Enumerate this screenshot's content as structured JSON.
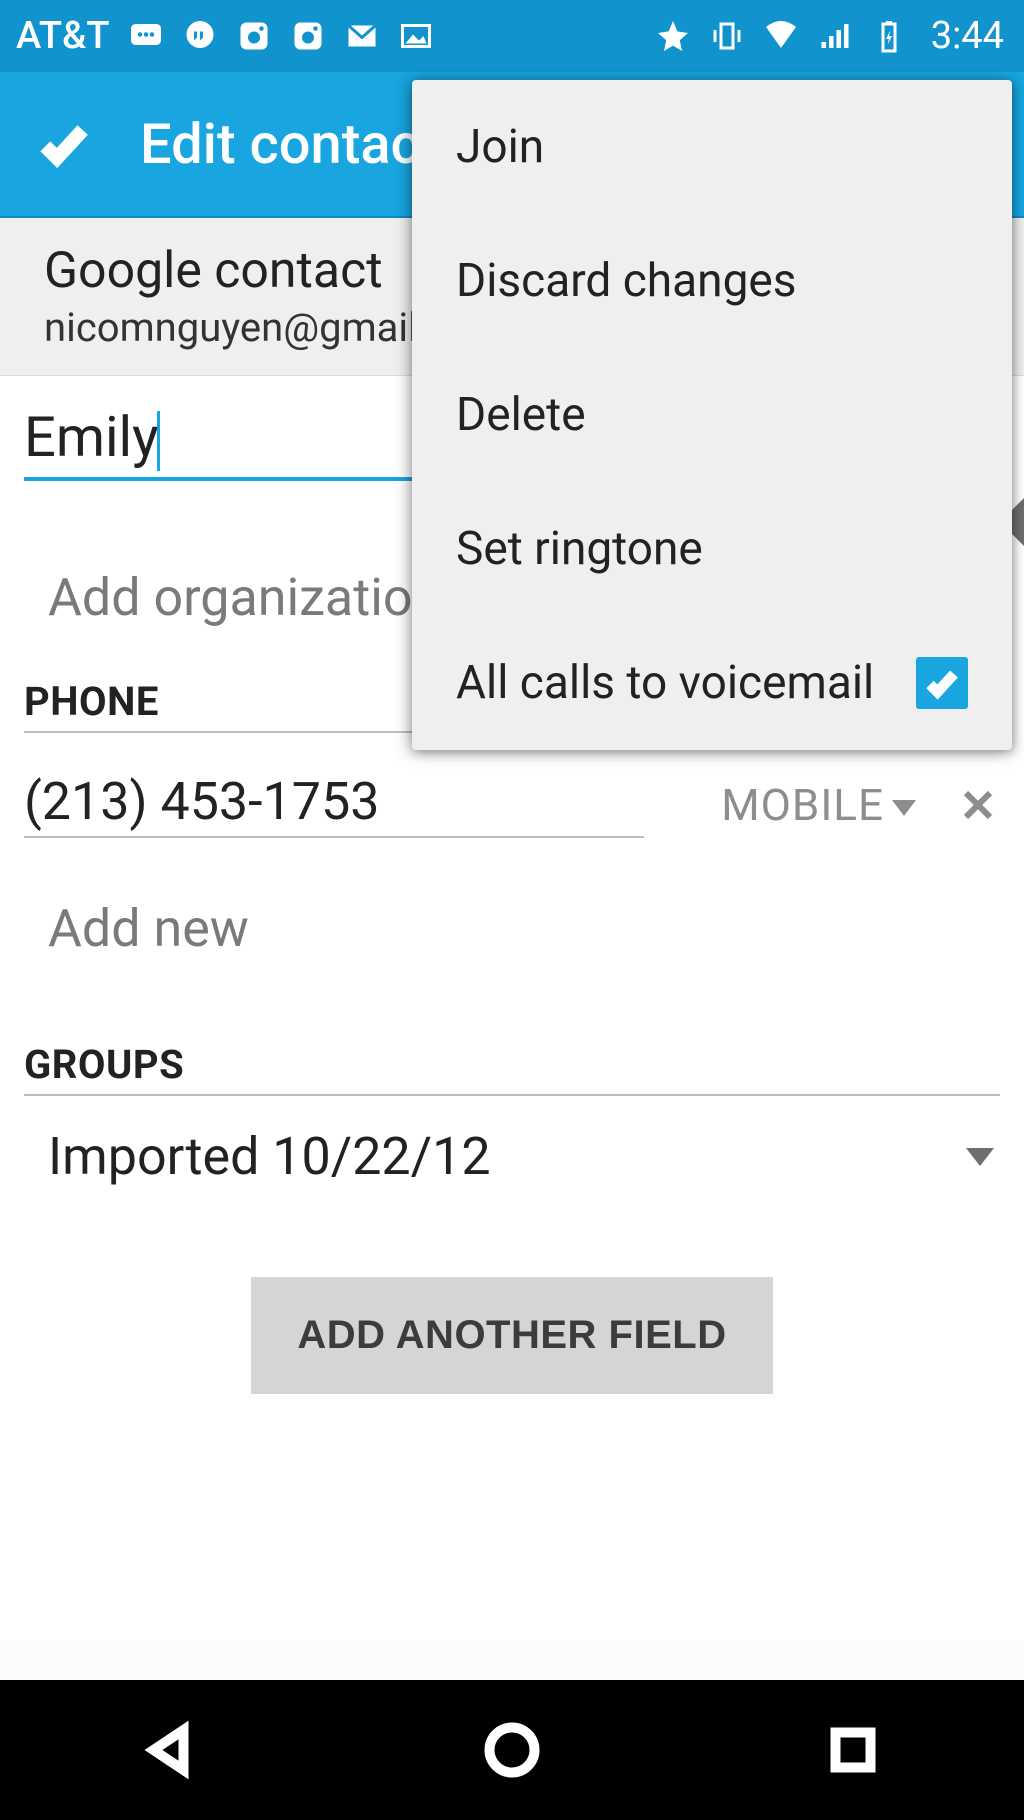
{
  "status": {
    "carrier": "AT&T",
    "clock": "3:44"
  },
  "appbar": {
    "title": "Edit contact"
  },
  "account": {
    "type": "Google contact",
    "email": "nicomnguyen@gmail"
  },
  "fields": {
    "name_value": "Emily",
    "org_placeholder": "Add organization",
    "phone_section": "PHONE",
    "phone_value": "(213) 453-1753",
    "phone_type": "MOBILE",
    "add_new": "Add new",
    "groups_section": "GROUPS",
    "group_value": "Imported 10/22/12",
    "add_field": "ADD ANOTHER FIELD"
  },
  "menu": {
    "items": [
      {
        "label": "Join"
      },
      {
        "label": "Discard changes"
      },
      {
        "label": "Delete"
      },
      {
        "label": "Set ringtone"
      },
      {
        "label": "All calls to voicemail",
        "checked": true
      }
    ]
  }
}
